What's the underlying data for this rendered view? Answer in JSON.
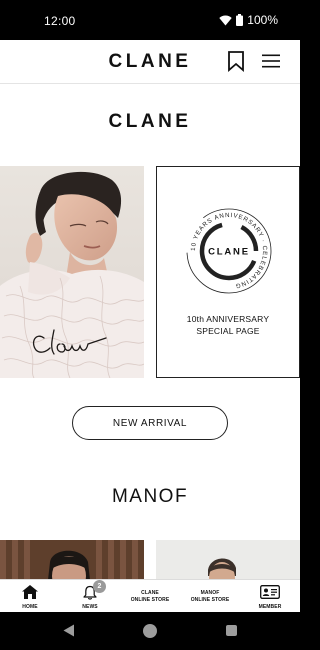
{
  "status_bar": {
    "time": "12:00",
    "battery": "100%",
    "icons": [
      "wifi-icon",
      "battery-icon"
    ]
  },
  "header": {
    "logo": "CLANE",
    "icons": [
      "bookmark-icon",
      "hamburger-menu-icon"
    ]
  },
  "main": {
    "brand_title": "CLANE",
    "banners": [
      {
        "kind": "photo",
        "signature": "Cla"
      },
      {
        "kind": "anniversary",
        "seal_center": "CLANE",
        "seal_ring": "10 YEARS ANNIVERSARY · CELEBRATING",
        "caption_line1": "10th ANNIVERSARY",
        "caption_line2": "SPECIAL PAGE"
      }
    ],
    "new_arrival_label": "NEW ARRIVAL",
    "section_title": "MANOF"
  },
  "tab_bar": {
    "tabs": [
      {
        "label": "HOME",
        "icon": "home-icon"
      },
      {
        "label": "NEWS",
        "icon": "bell-icon",
        "badge": "2"
      },
      {
        "label_line1": "CLANE",
        "label_line2": "ONLINE STORE"
      },
      {
        "label_line1": "MANOF",
        "label_line2": "ONLINE STORE"
      },
      {
        "label": "MEMBER",
        "icon": "member-card-icon"
      }
    ]
  },
  "system_nav": {
    "icons": [
      "back-icon",
      "home-circle-icon",
      "recents-icon"
    ]
  },
  "colors": {
    "background": "#ffffff",
    "text": "#111111",
    "badge": "#9a9a9a",
    "system_bar": "#000000"
  }
}
